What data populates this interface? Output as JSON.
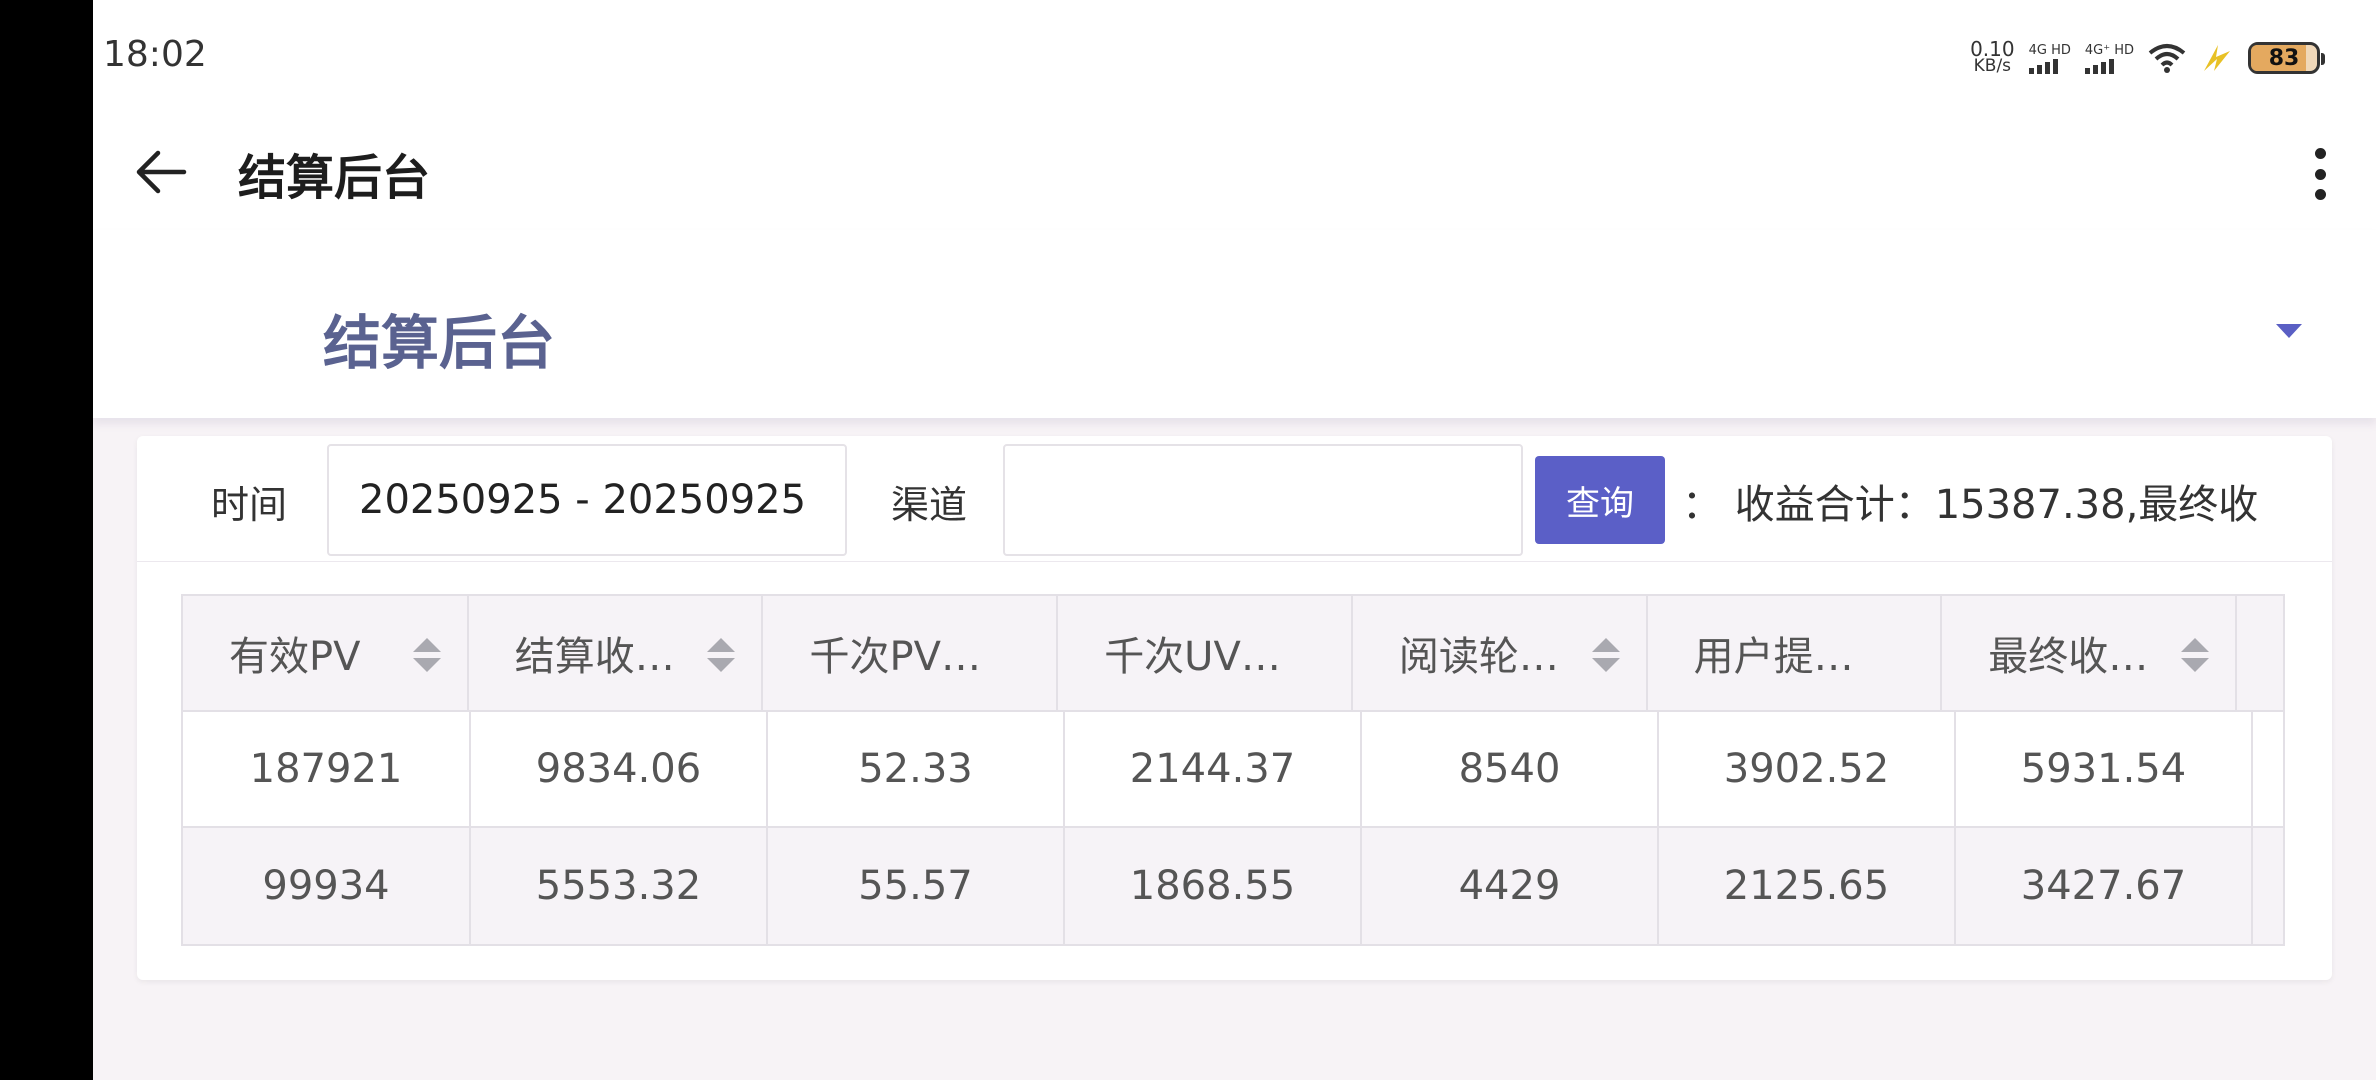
{
  "status_bar": {
    "time": "18:02",
    "net_speed_value": "0.10",
    "net_speed_unit": "KB/s",
    "signal1_label": "4G HD",
    "signal2_label": "4G⁺ HD",
    "battery": "83"
  },
  "app_bar": {
    "title": "结算后台"
  },
  "page_header": {
    "title": "结算后台"
  },
  "filters": {
    "time_label": "时间",
    "time_value": "20250925 - 20250925",
    "channel_label": "渠道",
    "channel_value": "",
    "query_button": "查询",
    "summary": "：  收益合计：15387.38,最终收"
  },
  "table": {
    "columns": [
      "有效PV",
      "结算收…",
      "千次PV…",
      "千次UV…",
      "阅读轮…",
      "用户提…",
      "最终收…"
    ],
    "rows": [
      [
        "187921",
        "9834.06",
        "52.33",
        "2144.37",
        "8540",
        "3902.52",
        "5931.54"
      ],
      [
        "99934",
        "5553.32",
        "55.57",
        "1868.55",
        "4429",
        "2125.65",
        "3427.67"
      ]
    ]
  }
}
